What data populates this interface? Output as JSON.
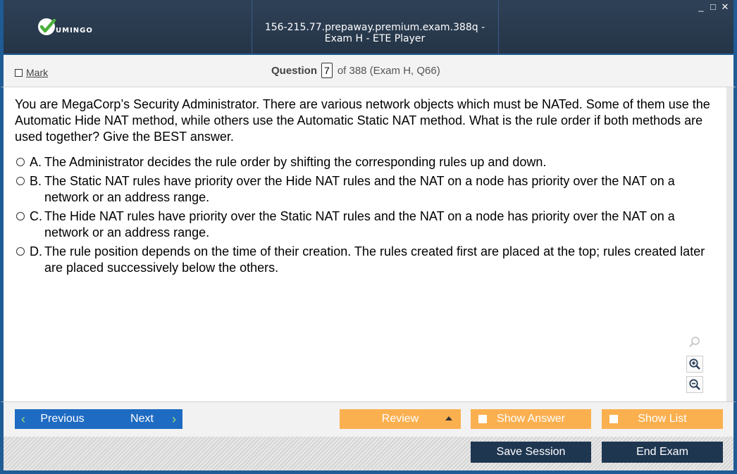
{
  "titlebar": {
    "logo_text": "UMINGO",
    "title": "156-215.77.prepaway.premium.exam.388q - Exam H - ETE Player",
    "controls": [
      "_",
      "□",
      "✕"
    ]
  },
  "header": {
    "mark_label": "Mark",
    "question_label": "Question",
    "question_number": "7",
    "question_of": "of 388 (Exam H, Q66)"
  },
  "question": {
    "text": "You are MegaCorp’s Security Administrator. There are various network objects which must be NATed. Some of them use the Automatic Hide NAT method, while others use the Automatic Static NAT method. What is the rule order if both methods are used together? Give the BEST answer.",
    "options": [
      {
        "letter": "A.",
        "text": "The Administrator decides the rule order by shifting the corresponding rules up and down."
      },
      {
        "letter": "B.",
        "text": "The Static NAT rules have priority over the Hide NAT rules and the NAT on a node has priority over the NAT on a network or an address range."
      },
      {
        "letter": "C.",
        "text": "The Hide NAT rules have priority over the Static NAT rules and the NAT on a node has priority over the NAT on a network or an address range."
      },
      {
        "letter": "D.",
        "text": "The rule position depends on the time of their creation. The rules created first are placed at the top; rules created later are placed successively below the others."
      }
    ]
  },
  "zoom_icons": [
    "search-icon",
    "zoom-in-icon",
    "zoom-out-icon"
  ],
  "nav": {
    "previous": "Previous",
    "next": "Next",
    "review": "Review",
    "show_answer": "Show Answer",
    "show_list": "Show List"
  },
  "footer": {
    "save_session": "Save Session",
    "end_exam": "End Exam"
  },
  "colors": {
    "titlebar": "#2f4157",
    "frame_blue": "#1f5b95",
    "nav_blue": "#1e6bc3",
    "orange": "#fbb050",
    "dark_button": "#1f3651",
    "arrow_green": "#9fe06f"
  }
}
